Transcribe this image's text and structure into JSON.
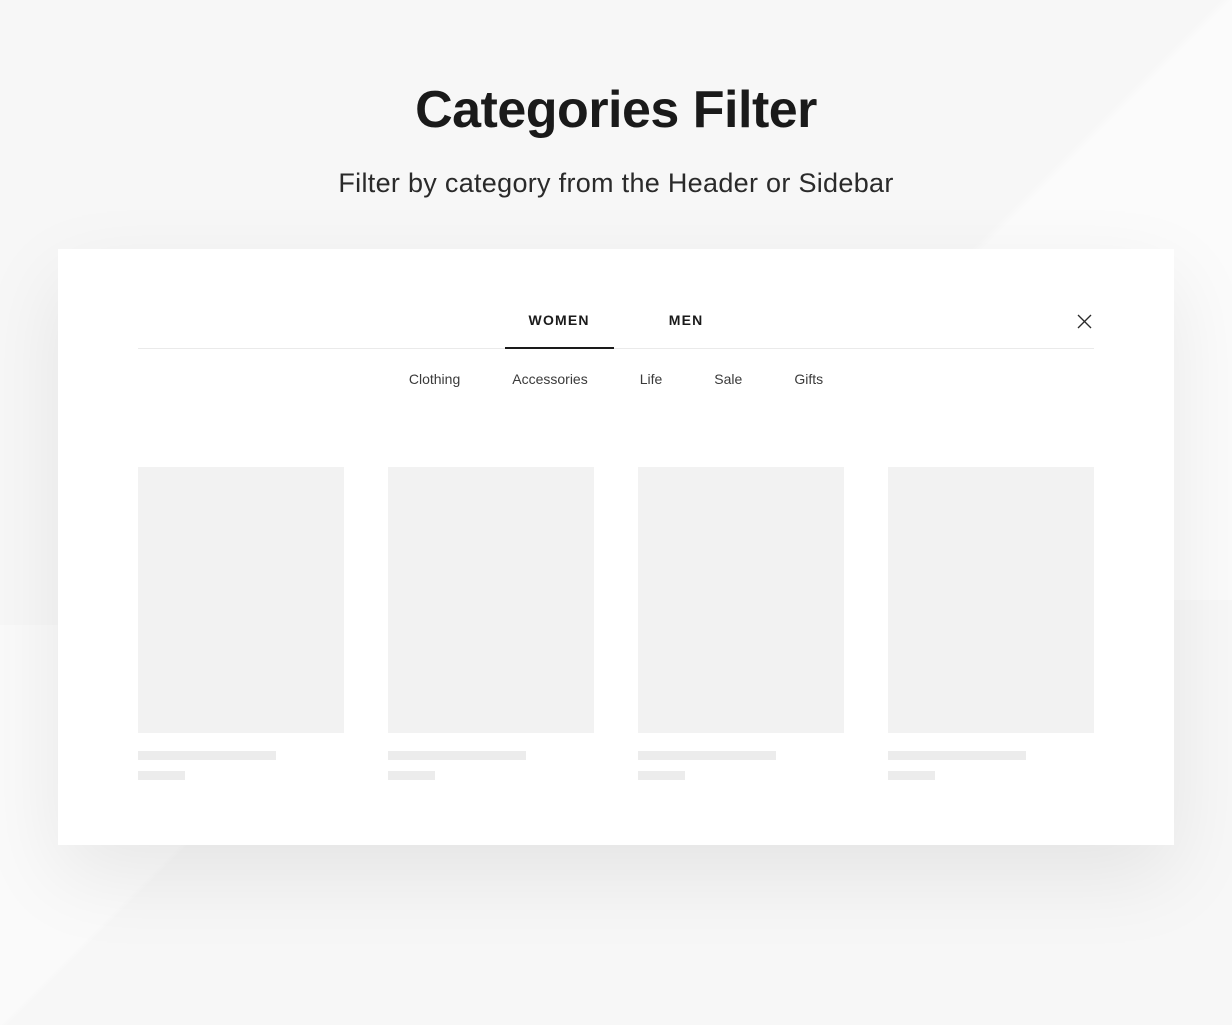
{
  "header": {
    "title": "Categories Filter",
    "subtitle": "Filter by category from the Header or Sidebar"
  },
  "panel": {
    "close_icon": "close",
    "primary_tabs": [
      {
        "label": "WOMEN",
        "active": true
      },
      {
        "label": "MEN",
        "active": false
      }
    ],
    "secondary_tabs": [
      {
        "label": "Clothing"
      },
      {
        "label": "Accessories"
      },
      {
        "label": "Life"
      },
      {
        "label": "Sale"
      },
      {
        "label": "Gifts"
      }
    ],
    "products_count": 4
  },
  "colors": {
    "bg": "#f7f7f7",
    "panel_bg": "#ffffff",
    "text_primary": "#1a1a1a",
    "text_secondary": "#3a3a3a",
    "skeleton": "#f2f2f2",
    "divider": "#eaeaea"
  }
}
